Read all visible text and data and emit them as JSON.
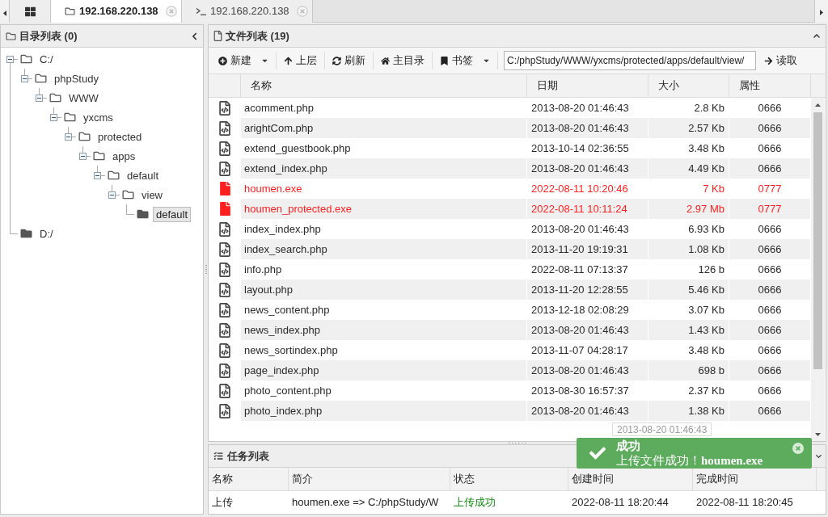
{
  "tab_bar": {
    "tabs": [
      {
        "kind": "grid",
        "selected": false
      },
      {
        "kind": "files",
        "label": "192.168.220.138",
        "selected": true
      },
      {
        "kind": "terminal",
        "label": "192.168.220.138",
        "selected": false
      }
    ]
  },
  "directory_panel": {
    "title": "目录列表 (0)",
    "tree": [
      {
        "label": "C:/",
        "expanded": true,
        "selected": false,
        "children": [
          {
            "label": "phpStudy",
            "expanded": true,
            "selected": false,
            "children": [
              {
                "label": "WWW",
                "expanded": true,
                "selected": false,
                "children": [
                  {
                    "label": "yxcms",
                    "expanded": true,
                    "selected": false,
                    "children": [
                      {
                        "label": "protected",
                        "expanded": true,
                        "selected": false,
                        "children": [
                          {
                            "label": "apps",
                            "expanded": true,
                            "selected": false,
                            "children": [
                              {
                                "label": "default",
                                "expanded": true,
                                "selected": false,
                                "children": [
                                  {
                                    "label": "view",
                                    "expanded": true,
                                    "selected": false,
                                    "children": [
                                      {
                                        "label": "default",
                                        "expanded": false,
                                        "selected": true
                                      }
                                    ]
                                  }
                                ]
                              }
                            ]
                          }
                        ]
                      }
                    ]
                  }
                ]
              }
            ]
          }
        ]
      },
      {
        "label": "D:/",
        "expanded": false,
        "selected": false
      }
    ]
  },
  "file_panel": {
    "title": "文件列表 (19)",
    "toolbar": [
      {
        "kind": "new",
        "label": "新建",
        "dropdown": true
      },
      {
        "kind": "up",
        "label": "上层",
        "dropdown": false
      },
      {
        "kind": "refresh",
        "label": "刷新",
        "dropdown": false
      },
      {
        "kind": "home",
        "label": "主目录",
        "dropdown": false
      },
      {
        "kind": "bookmark",
        "label": "书签",
        "dropdown": true
      }
    ],
    "path": {
      "value": "C:/phpStudy/WWW/yxcms/protected/apps/default/view/"
    },
    "read_button": {
      "label": "读取"
    },
    "columns": [
      "名称",
      "日期",
      "大小",
      "属性"
    ],
    "rows": [
      {
        "kind": "code",
        "name": "acomment.php",
        "date": "2013-08-20 01:46:43",
        "size": "2.8 Kb",
        "mode": "0666"
      },
      {
        "kind": "code",
        "name": "arightCom.php",
        "date": "2013-08-20 01:46:43",
        "size": "2.57 Kb",
        "mode": "0666"
      },
      {
        "kind": "code",
        "name": "extend_guestbook.php",
        "date": "2013-10-14 02:36:55",
        "size": "3.48 Kb",
        "mode": "0666"
      },
      {
        "kind": "code",
        "name": "extend_index.php",
        "date": "2013-08-20 01:46:43",
        "size": "4.49 Kb",
        "mode": "0666"
      },
      {
        "kind": "executable",
        "name": "houmen.exe",
        "date": "2022-08-11 10:20:46",
        "size": "7 Kb",
        "mode": "0777"
      },
      {
        "kind": "executable",
        "name": "houmen_protected.exe",
        "date": "2022-08-11 10:11:24",
        "size": "2.97 Mb",
        "mode": "0777"
      },
      {
        "kind": "code",
        "name": "index_index.php",
        "date": "2013-08-20 01:46:43",
        "size": "6.93 Kb",
        "mode": "0666"
      },
      {
        "kind": "code",
        "name": "index_search.php",
        "date": "2013-11-20 19:19:31",
        "size": "1.08 Kb",
        "mode": "0666"
      },
      {
        "kind": "code",
        "name": "info.php",
        "date": "2022-08-11 07:13:37",
        "size": "126 b",
        "mode": "0666"
      },
      {
        "kind": "code",
        "name": "layout.php",
        "date": "2013-11-20 12:28:55",
        "size": "5.46 Kb",
        "mode": "0666"
      },
      {
        "kind": "code",
        "name": "news_content.php",
        "date": "2013-12-18 02:08:29",
        "size": "3.07 Kb",
        "mode": "0666"
      },
      {
        "kind": "code",
        "name": "news_index.php",
        "date": "2013-08-20 01:46:43",
        "size": "1.43 Kb",
        "mode": "0666"
      },
      {
        "kind": "code",
        "name": "news_sortindex.php",
        "date": "2013-11-07 04:28:17",
        "size": "3.48 Kb",
        "mode": "0666"
      },
      {
        "kind": "code",
        "name": "page_index.php",
        "date": "2013-08-20 01:46:43",
        "size": "698 b",
        "mode": "0666"
      },
      {
        "kind": "code",
        "name": "photo_content.php",
        "date": "2013-08-30 16:57:37",
        "size": "2.37 Kb",
        "mode": "0666"
      },
      {
        "kind": "code",
        "name": "photo_index.php",
        "date": "2013-08-20 01:46:43",
        "size": "1.38 Kb",
        "mode": "0666"
      }
    ],
    "tooltip": "2013-08-20 01:46:43"
  },
  "task_panel": {
    "title": "任务列表",
    "columns": [
      "名称",
      "简介",
      "状态",
      "创建时间",
      "完成时间"
    ],
    "rows": [
      {
        "name": "上传",
        "summary": "houmen.exe => C:/phpStudy/W",
        "status": "上传成功",
        "success": true,
        "created": "2022-08-11 18:20:44",
        "finished": "2022-08-11 18:20:45"
      }
    ]
  },
  "toast": {
    "title": "成功",
    "message": "上传文件成功！**houmen.exe**"
  }
}
